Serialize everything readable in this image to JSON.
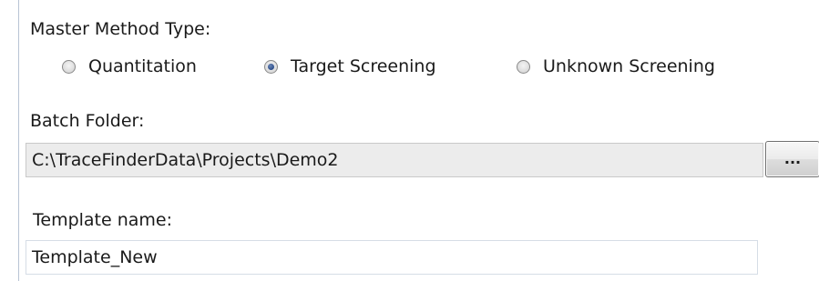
{
  "method_type": {
    "label": "Master Method Type:",
    "options": [
      {
        "label": "Quantitation",
        "checked": false
      },
      {
        "label": "Target Screening",
        "checked": true
      },
      {
        "label": "Unknown Screening",
        "checked": false
      }
    ]
  },
  "batch_folder": {
    "label": "Batch Folder:",
    "value": "C:\\TraceFinderData\\Projects\\Demo2",
    "browse_label": "..."
  },
  "template": {
    "label": "Template name:",
    "value": "Template_New"
  }
}
